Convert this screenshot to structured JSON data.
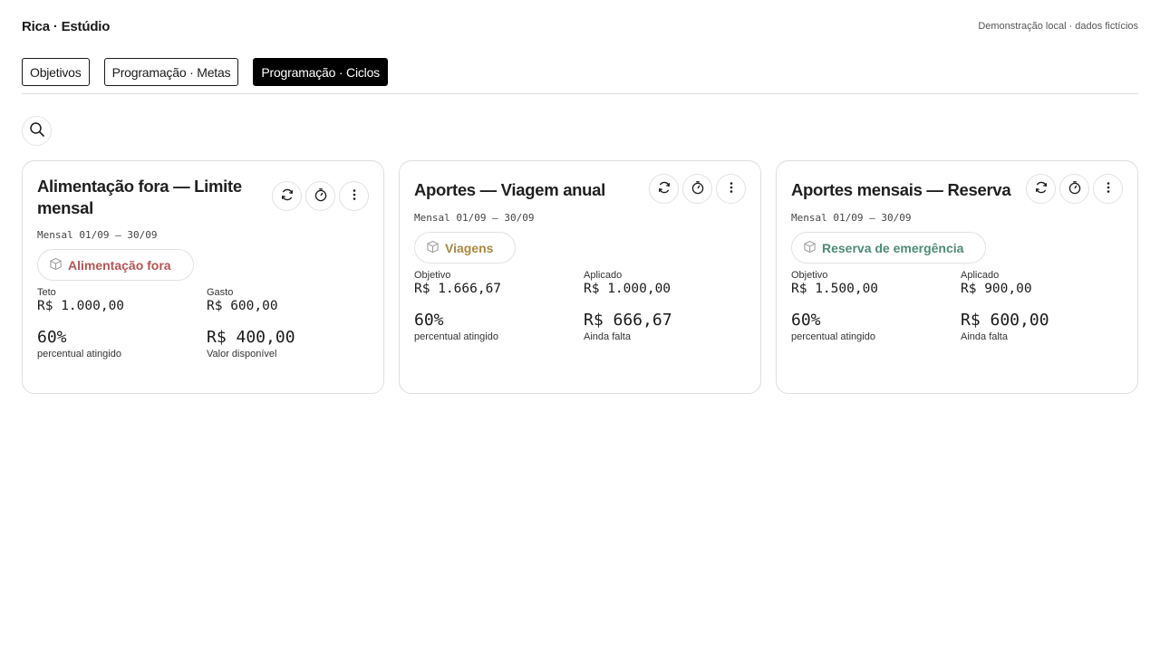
{
  "header": {
    "brand": "Rica · Estúdio",
    "note": "Demonstração local · dados fictícios"
  },
  "tabs": [
    {
      "label": "Objetivos",
      "active": false
    },
    {
      "label": "Programação · Metas",
      "active": false
    },
    {
      "label": "Programação · Ciclos",
      "active": true
    }
  ],
  "icons": {
    "search": "search-icon",
    "refresh": "refresh-icon",
    "timer": "timer-icon",
    "more": "more-vertical-icon",
    "tag": "box-icon"
  },
  "colors": {
    "red_tag": "#b05656",
    "gold_tag": "#a88942",
    "green_tag": "#4f8a76",
    "active_tab": "#000000"
  },
  "cards": [
    {
      "title": "Alimentação fora — Limite mensal",
      "period": "Mensal 01/09 – 30/09",
      "tag": "Alimentação fora",
      "label_a": "Teto",
      "value_a": "R$ 1.000,00",
      "label_b": "Gasto",
      "value_b": "R$ 600,00",
      "percent": "60%",
      "percent_label": "percentual atingido",
      "remaining": "R$ 400,00",
      "remaining_label": "Valor disponível"
    },
    {
      "title": "Aportes — Viagem anual",
      "period": "Mensal 01/09 – 30/09",
      "tag": "Viagens",
      "label_a": "Objetivo",
      "value_a": "R$ 1.666,67",
      "label_b": "Aplicado",
      "value_b": "R$ 1.000,00",
      "percent": "60%",
      "percent_label": "percentual atingido",
      "remaining": "R$ 666,67",
      "remaining_label": "Ainda falta"
    },
    {
      "title": "Aportes mensais — Reserva",
      "period": "Mensal 01/09 – 30/09",
      "tag": "Reserva de emergência",
      "label_a": "Objetivo",
      "value_a": "R$ 1.500,00",
      "label_b": "Aplicado",
      "value_b": "R$ 900,00",
      "percent": "60%",
      "percent_label": "percentual atingido",
      "remaining": "R$ 600,00",
      "remaining_label": "Ainda falta"
    }
  ]
}
